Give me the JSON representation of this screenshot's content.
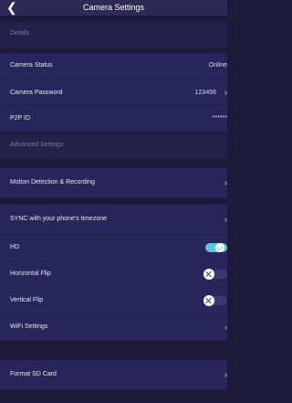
{
  "header": {
    "title": "Camera Settings",
    "back_icon": "chevron-left-icon"
  },
  "sections": {
    "details": "Details",
    "advanced": "Advanced Settings"
  },
  "details": {
    "camera_status": {
      "label": "Camera Status",
      "value": "Online"
    },
    "camera_password": {
      "label": "Camera Password",
      "value": "123456"
    },
    "p2p_id": {
      "label": "P2P ID",
      "value": "******"
    }
  },
  "advanced": {
    "motion": {
      "label": "Motion Detection & Recording"
    },
    "sync": {
      "label": "SYNC with your phone's timezone"
    },
    "hd": {
      "label": "HD",
      "enabled": true
    },
    "horizontal_flip": {
      "label": "Horizontal Flip",
      "enabled": false
    },
    "vertical_flip": {
      "label": "Vertical Flip",
      "enabled": false
    },
    "wifi": {
      "label": "WiFi Settings"
    },
    "format_sd": {
      "label": "Format SD Card"
    }
  },
  "colors": {
    "background": "#1c1a38",
    "row": "#28255a",
    "toggle_on": "#5ec7d6",
    "toggle_off": "#3b3970"
  }
}
